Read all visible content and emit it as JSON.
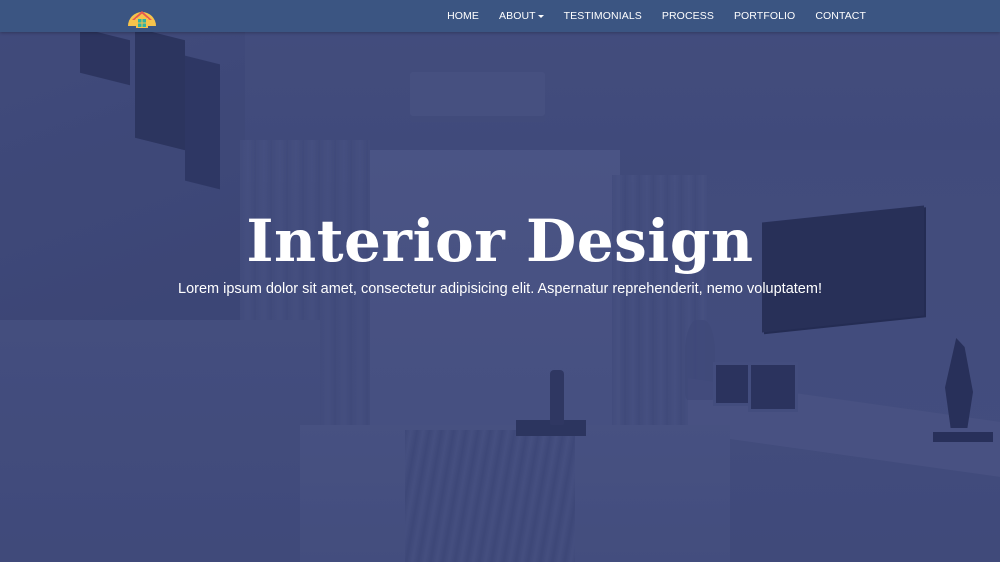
{
  "brand": {
    "logo_icon": "house-sunset-icon",
    "logo_colors": [
      "#f6c34b",
      "#e6584f",
      "#2fb3a3"
    ]
  },
  "nav": {
    "items": [
      {
        "label": "HOME"
      },
      {
        "label": "ABOUT",
        "has_dropdown": true
      },
      {
        "label": "TESTIMONIALS"
      },
      {
        "label": "PROCESS"
      },
      {
        "label": "PORTFOLIO"
      },
      {
        "label": "CONTACT"
      }
    ]
  },
  "hero": {
    "title": "Interior Design",
    "subtitle": "Lorem ipsum dolor sit amet, consectetur adipisicing elit. Aspernatur reprehenderit, nemo voluptatem!"
  },
  "colors": {
    "navbar": "#3b5582",
    "overlay": "#2e386e",
    "text": "#ffffff"
  }
}
